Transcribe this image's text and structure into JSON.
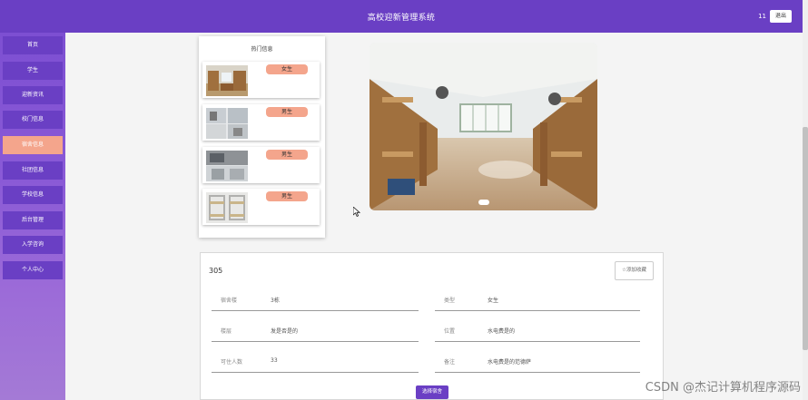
{
  "header": {
    "title": "高校迎新管理系统",
    "user": "11",
    "logout_label": "退出"
  },
  "sidebar": {
    "items": [
      {
        "label": "首页"
      },
      {
        "label": "学生"
      },
      {
        "label": "迎新资讯"
      },
      {
        "label": "校门信息"
      },
      {
        "label": "宿舍信息",
        "active": true
      },
      {
        "label": "社团信息"
      },
      {
        "label": "学校信息"
      },
      {
        "label": "后台管理"
      },
      {
        "label": "入学咨询"
      },
      {
        "label": "个人中心"
      }
    ]
  },
  "hot": {
    "title": "热门信息",
    "items": [
      {
        "tag": "女生"
      },
      {
        "tag": "男生"
      },
      {
        "tag": "男生"
      },
      {
        "tag": "男生"
      }
    ]
  },
  "detail": {
    "room": "305",
    "fav_label": "☆添加收藏",
    "fields_left": [
      {
        "label": "宿舍楼",
        "value": "3栋"
      },
      {
        "label": "楼层",
        "value": "发是否是的"
      },
      {
        "label": "可住人数",
        "value": "33"
      }
    ],
    "fields_right": [
      {
        "label": "类型",
        "value": "女生"
      },
      {
        "label": "位置",
        "value": "水电费是的"
      },
      {
        "label": "备注",
        "value": "水电费是的范德萨"
      }
    ],
    "select_label": "选择宿舍"
  },
  "watermark": "CSDN @杰记计算机程序源码",
  "colors": {
    "primary": "#6a3fc4",
    "accent": "#f4a58c"
  }
}
